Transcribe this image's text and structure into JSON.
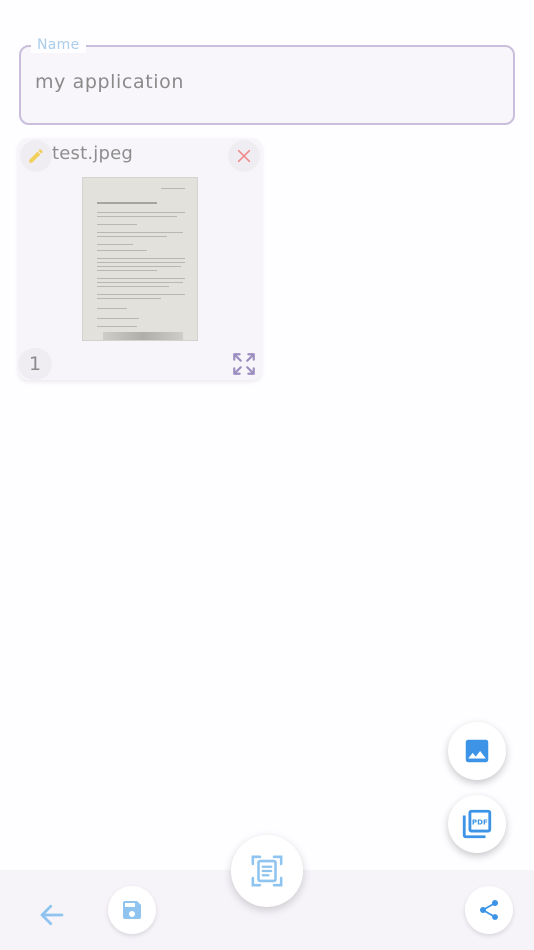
{
  "name_field": {
    "label": "Name",
    "value": "my application"
  },
  "file_card": {
    "file_name": "test.jpeg",
    "page_number": "1"
  },
  "icons": {
    "edit": "pencil-icon",
    "close": "close-icon",
    "expand": "fullscreen-icon",
    "add_image": "image-icon",
    "add_pdf": "pdf-icon",
    "back": "arrow-left-icon",
    "save": "save-icon",
    "scan": "document-scanner-icon",
    "share": "share-icon"
  },
  "colors": {
    "accent_blue": "#3d94e6",
    "edit_yellow": "#f2cf5b",
    "close_red": "#f08a8a",
    "expand_purple": "#9b8fbf",
    "field_border": "#c9bfdc",
    "label_blue": "#a9cdea"
  }
}
